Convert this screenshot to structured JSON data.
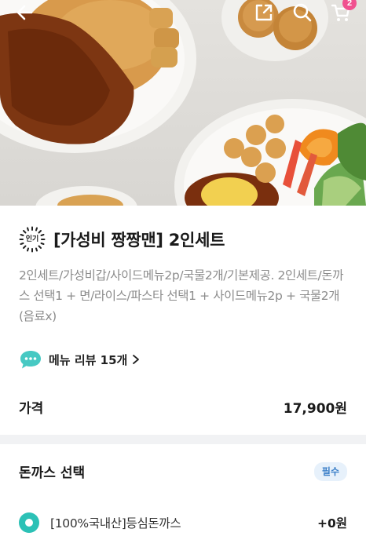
{
  "header": {
    "back_icon": "arrow-left-icon",
    "share_icon": "share-icon",
    "search_icon": "search-icon",
    "cart_icon": "cart-icon",
    "cart_count": "2"
  },
  "product": {
    "badge": "인기",
    "title": "[가성비 짱짱맨] 2인세트",
    "description": "2인세트/가성비갑/사이드메뉴2p/국물2개/기본제공. 2인세트/돈까스 선택1 + 면/라이스/파스타 선택1 + 사이드메뉴2p + 국물2개(음료x)",
    "review_label": "메뉴 리뷰 15개",
    "price_label": "가격",
    "price_value": "17,900원"
  },
  "options": {
    "section_title": "돈까스 선택",
    "required_badge": "필수",
    "items": [
      {
        "label": "[100%국내산]등심돈까스",
        "price": "+0원"
      }
    ]
  },
  "colors": {
    "accent": "#2cc1b6",
    "cart_badge": "#f0508f",
    "required_badge_bg": "#e7f1fb",
    "required_badge_text": "#3b7fc8",
    "review_bubble": "#47c9c3"
  }
}
